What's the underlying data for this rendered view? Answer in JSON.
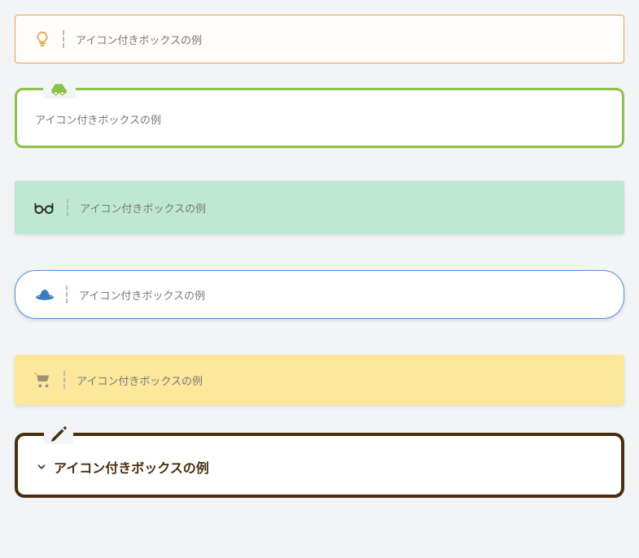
{
  "boxes": {
    "box1": {
      "text": "アイコン付きボックスの例",
      "icon": "lightbulb",
      "accent": "#e5a24a"
    },
    "box2": {
      "text": "アイコン付きボックスの例",
      "icon": "car",
      "accent": "#8bc34a"
    },
    "box3": {
      "text": "アイコン付きボックスの例",
      "icon": "glasses",
      "accent": "#bfe8d2"
    },
    "box4": {
      "text": "アイコン付きボックスの例",
      "icon": "hat",
      "accent": "#4a90d9"
    },
    "box5": {
      "text": "アイコン付きボックスの例",
      "icon": "cart",
      "accent": "#fce79a"
    },
    "box6": {
      "text": "アイコン付きボックスの例",
      "icon": "pencil",
      "accent": "#4a2e0f"
    }
  }
}
